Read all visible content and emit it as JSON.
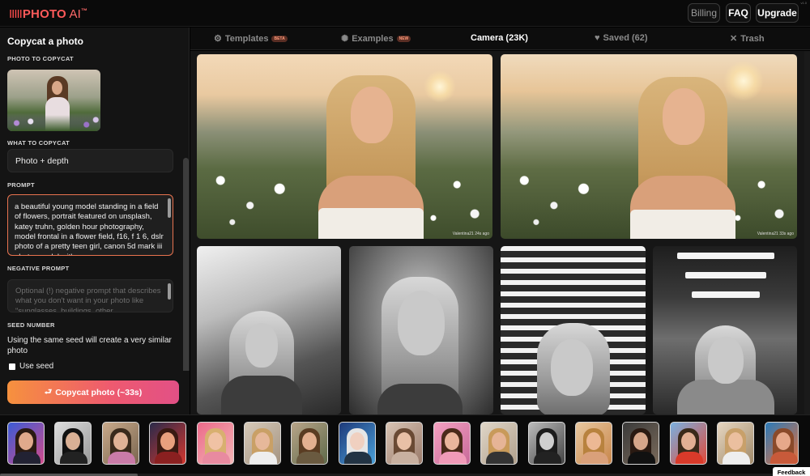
{
  "header": {
    "logo_bars": "IIIII",
    "logo_text": "PHOTO",
    "logo_ai": " AI",
    "logo_tm": "™",
    "version": "v1.0",
    "nav": {
      "billing": "Billing",
      "faq": "FAQ",
      "upgrade": "Upgrade"
    }
  },
  "sidebar": {
    "title": "Copycat a photo",
    "photo_label": "PHOTO TO COPYCAT",
    "what_label": "WHAT TO COPYCAT",
    "what_value": "Photo + depth",
    "prompt_label": "PROMPT",
    "prompt_value": "a beautiful young model standing in a field of flowers, portrait featured on unsplash, katey truhn, golden hour photography, model frontal in a flower field, f16, f 1 6, dslr photo of a pretty teen girl, canon 5d mark iii photo, model with",
    "negative_label": "NEGATIVE PROMPT",
    "negative_placeholder": "Optional (!) negative prompt that describes what you don't want in your photo like \"sunglasses, buildings, other",
    "seed_label": "SEED NUMBER",
    "seed_desc": "Using the same seed will create a very similar photo",
    "use_seed": "Use seed",
    "copycat_button": "Copycat photo (~33s)",
    "copycat_icon": "return-arrow-icon"
  },
  "tabs": [
    {
      "label": "Templates",
      "badge": "BETA",
      "icon": "gear-icon"
    },
    {
      "label": "Examples",
      "badge": "NEW",
      "icon": "sparkle-icon"
    },
    {
      "label": "Camera (23K)",
      "badge": "",
      "icon": ""
    },
    {
      "label": "Saved (62)",
      "badge": "",
      "icon": "heart-icon"
    },
    {
      "label": "Trash",
      "badge": "",
      "icon": "x-icon"
    }
  ],
  "gallery": {
    "credits": [
      "Valentina21 24s ago",
      "Valentina21 33s ago"
    ]
  },
  "feedback": "Feedback",
  "colors": {
    "accent_start": "#f6913e",
    "accent_end": "#e25086",
    "logo": "#ff5a5a",
    "prompt_border": "#e8734f"
  }
}
